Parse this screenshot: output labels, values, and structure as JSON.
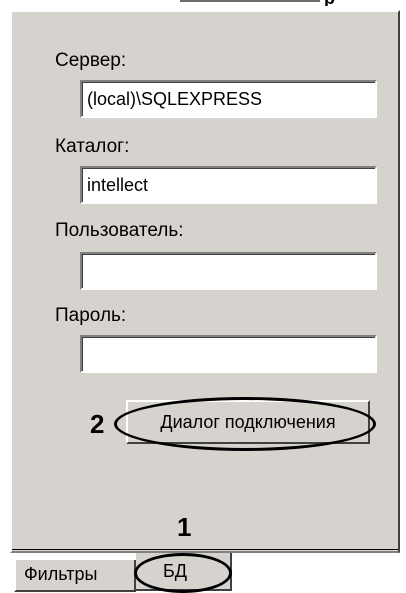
{
  "form": {
    "server": {
      "label": "Сервер:",
      "value": "(local)\\SQLEXPRESS"
    },
    "catalog": {
      "label": "Каталог:",
      "value": "intellect"
    },
    "user": {
      "label": "Пользователь:",
      "value": ""
    },
    "password": {
      "label": "Пароль:",
      "value": ""
    }
  },
  "buttons": {
    "connect_dialog": "Диалог подключения"
  },
  "tabs": [
    {
      "label": "Фильтры",
      "selected": false
    },
    {
      "label": "БД",
      "selected": true
    }
  ],
  "callouts": {
    "tab_marker": "1",
    "button_marker": "2"
  },
  "top_fragment_text": "р"
}
